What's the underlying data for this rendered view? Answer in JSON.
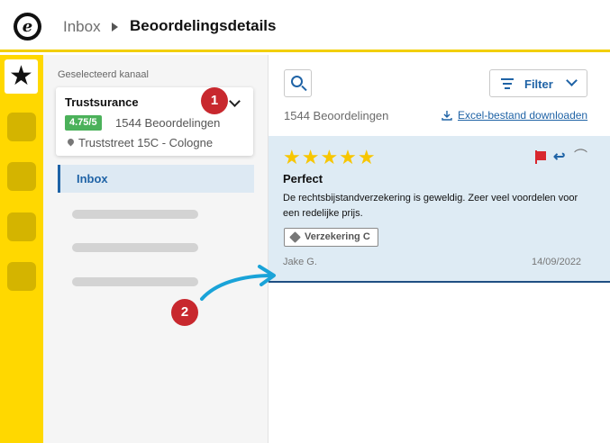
{
  "header": {
    "logo_letter": "e",
    "breadcrumb_root": "Inbox",
    "breadcrumb_current": "Beoordelingsdetails",
    "accent_color": "#f2cf00"
  },
  "rail": {
    "active_icon": "star-icon",
    "active_glyph": "★",
    "items": [
      "rail-item",
      "rail-item",
      "rail-item",
      "rail-item"
    ]
  },
  "channel": {
    "label": "Geselecteerd kanaal",
    "name": "Trustsurance",
    "score": "4.75/5",
    "review_count": "1544 Beoordelingen",
    "address": "Truststreet 15C - Cologne"
  },
  "nav": {
    "inbox_label": "Inbox"
  },
  "toolbar": {
    "filter_label": "Filter",
    "total_reviews": "1544 Beoordelingen",
    "download_label": "Excel-bestand downloaden"
  },
  "review": {
    "stars": "★★★★★",
    "rating": 5,
    "title": "Perfect",
    "text": "De rechtsbijstandverzekering is geweldig. Zeer veel voordelen voor een redelijke prijs.",
    "tag": "Verzekering C",
    "reviewer": "Jake G.",
    "date": "14/09/2022",
    "star_color": "#f7c600",
    "flag_color": "#d8272e"
  },
  "annotations": {
    "marker_1": "1",
    "marker_2": "2",
    "marker_color": "#c8282e",
    "arrow_color": "#1aa3d8"
  }
}
